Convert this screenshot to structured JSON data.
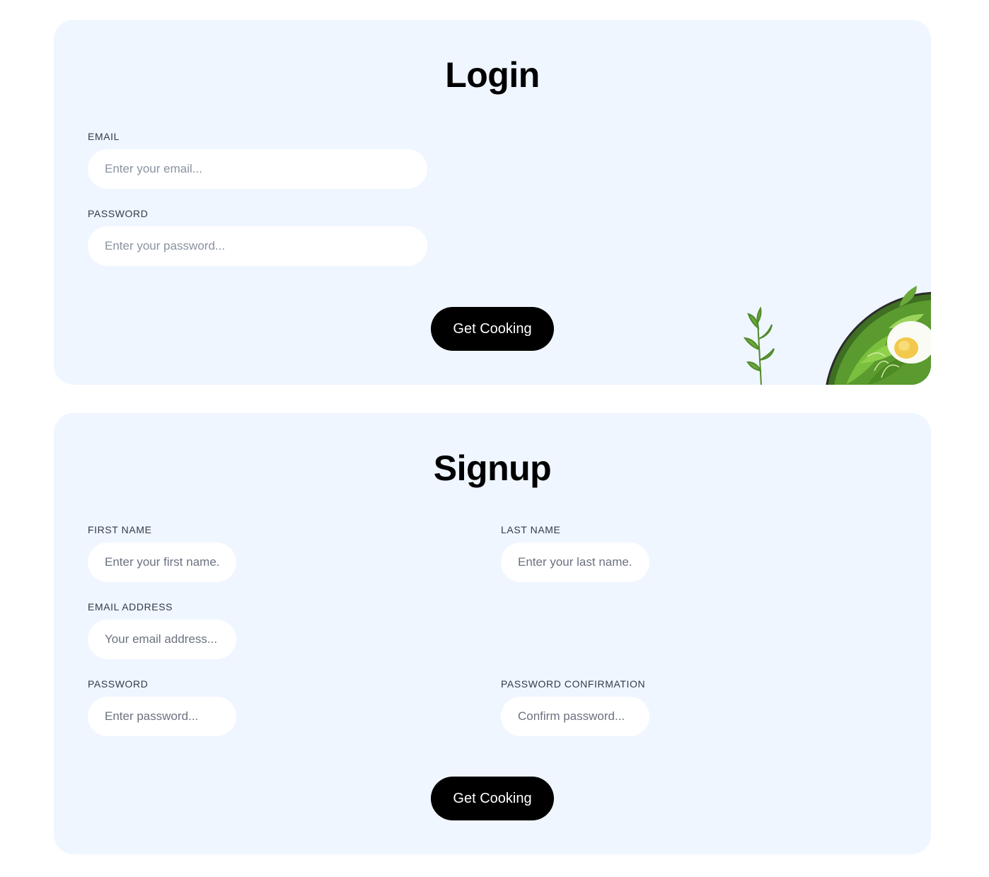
{
  "login": {
    "title": "Login",
    "email_label": "EMAIL",
    "email_placeholder": "Enter your email...",
    "email_value": "",
    "password_label": "PASSWORD",
    "password_placeholder": "Enter your password...",
    "password_value": "",
    "submit_label": "Get Cooking",
    "decoration": "salad-bowl-image"
  },
  "signup": {
    "title": "Signup",
    "first_name_label": "FIRST NAME",
    "first_name_placeholder": "Enter your first name...",
    "last_name_label": "LAST NAME",
    "last_name_placeholder": "Enter your last name...",
    "email_label": "EMAIL ADDRESS",
    "email_placeholder": "Your email address...",
    "password_label": "PASSWORD",
    "password_placeholder": "Enter password...",
    "password_confirmation_label": "PASSWORD CONFIRMATION",
    "password_confirmation_placeholder": "Confirm password...",
    "submit_label": "Get Cooking"
  },
  "colors": {
    "card_background": "#eff6ff",
    "input_background": "#ffffff",
    "button_background": "#000000",
    "button_text": "#ffffff",
    "label_text": "#333a45",
    "placeholder_text": "#8a93a0"
  }
}
